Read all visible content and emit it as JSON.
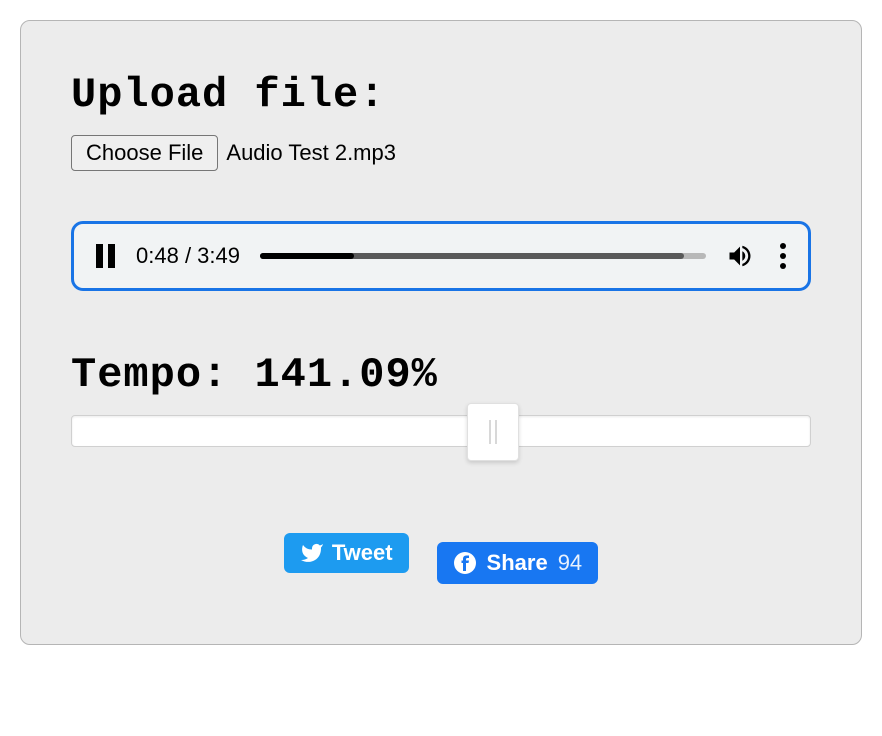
{
  "upload": {
    "heading": "Upload file:",
    "choose_button": "Choose File",
    "filename": "Audio Test 2.mp3"
  },
  "player": {
    "current_time": "0:48",
    "duration": "3:49",
    "time_separator": " / ",
    "played_percent": 21,
    "buffered_percent": 95
  },
  "tempo": {
    "label": "Tempo:",
    "value": "141.09%",
    "slider_position_percent": 57
  },
  "social": {
    "tweet_label": "Tweet",
    "fb_share_label": "Share",
    "fb_share_count": "94"
  }
}
